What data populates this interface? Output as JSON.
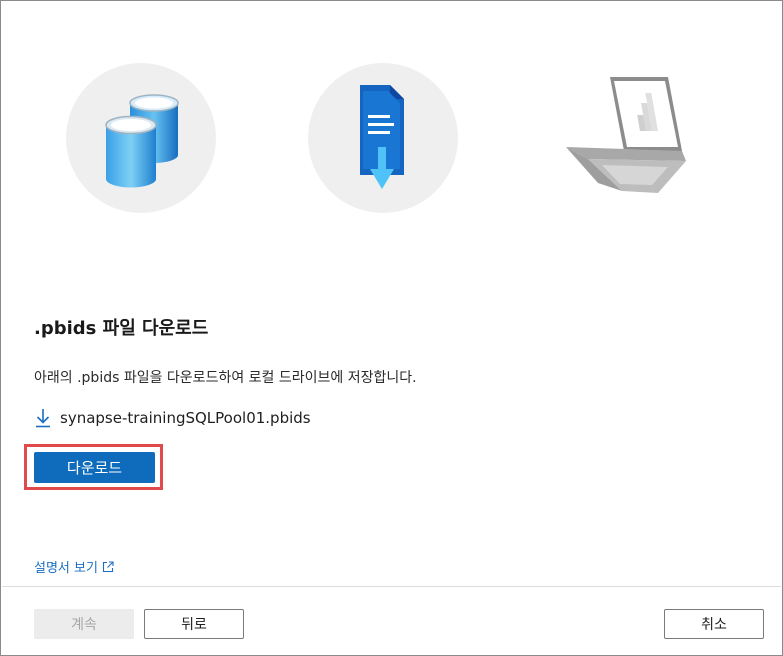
{
  "dialog": {
    "illustrations": [
      {
        "icon": "database-icon"
      },
      {
        "icon": "file-download-icon"
      },
      {
        "icon": "laptop-icon"
      }
    ],
    "title": ".pbids 파일 다운로드",
    "description": "아래의 .pbids 파일을 다운로드하여 로컬 드라이브에 저장합니다.",
    "file": {
      "icon": "download-icon",
      "name": "synapse-trainingSQLPool01.pbids"
    },
    "download_button": "다운로드",
    "doc_link": {
      "label": "설명서 보기",
      "icon": "external-link-icon"
    }
  },
  "footer": {
    "continue_label": "계속",
    "back_label": "뒤로",
    "cancel_label": "취소"
  },
  "colors": {
    "primary": "#0f6cbd",
    "link": "#1b6ec2",
    "highlight": "#e04a4a",
    "illustration_bg": "#efefef"
  }
}
